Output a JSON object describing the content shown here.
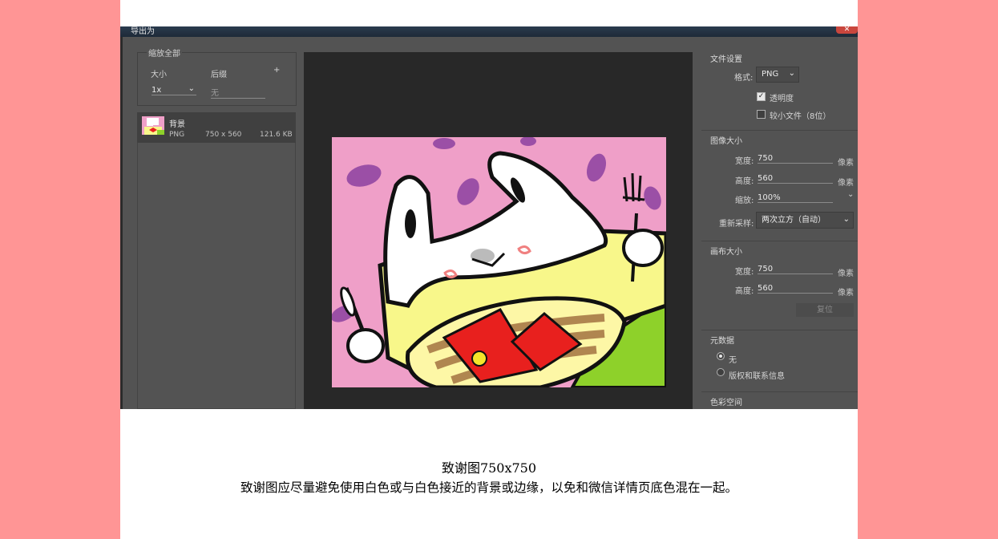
{
  "window": {
    "title": "导出为",
    "close_label": "✕"
  },
  "left_panel": {
    "scale_all_title": "缩放全部",
    "size_header": "大小",
    "suffix_header": "后缀",
    "add_label": "+",
    "size_value": "1x",
    "suffix_value": "无",
    "asset": {
      "name": "背景",
      "format": "PNG",
      "dimensions": "750 x 560",
      "filesize": "121.6 KB"
    }
  },
  "file_settings": {
    "title": "文件设置",
    "format_label": "格式:",
    "format_value": "PNG",
    "transparency_label": "透明度",
    "transparency_checked": true,
    "smaller_file_label": "较小文件（8位）",
    "smaller_file_checked": false
  },
  "image_size": {
    "title": "图像大小",
    "width_label": "宽度:",
    "width_value": "750",
    "height_label": "高度:",
    "height_value": "560",
    "scale_label": "缩放:",
    "scale_value": "100%",
    "unit": "像素",
    "resample_label": "重新采样:",
    "resample_value": "两次立方（自动）"
  },
  "canvas_size": {
    "title": "画布大小",
    "width_label": "宽度:",
    "width_value": "750",
    "height_label": "高度:",
    "height_value": "560",
    "unit": "像素",
    "reset_label": "复位"
  },
  "metadata": {
    "title": "元数据",
    "option_none": "无",
    "option_copyright": "版权和联系信息",
    "selected": "无"
  },
  "color_space": {
    "title": "色彩空间"
  },
  "caption": {
    "line1": "致谢图750x750",
    "line2": "致谢图应尽量避免使用白色或与白色接近的背景或边缘，以免和微信详情页底色混在一起。"
  },
  "colors": {
    "page_bg": "#ff9595",
    "panel_bg": "#535353",
    "preview_bg": "#282828",
    "art_pink": "#ef9fc8",
    "art_yellow": "#f8f78a",
    "art_green": "#8ed12a",
    "art_red": "#e8201e"
  }
}
